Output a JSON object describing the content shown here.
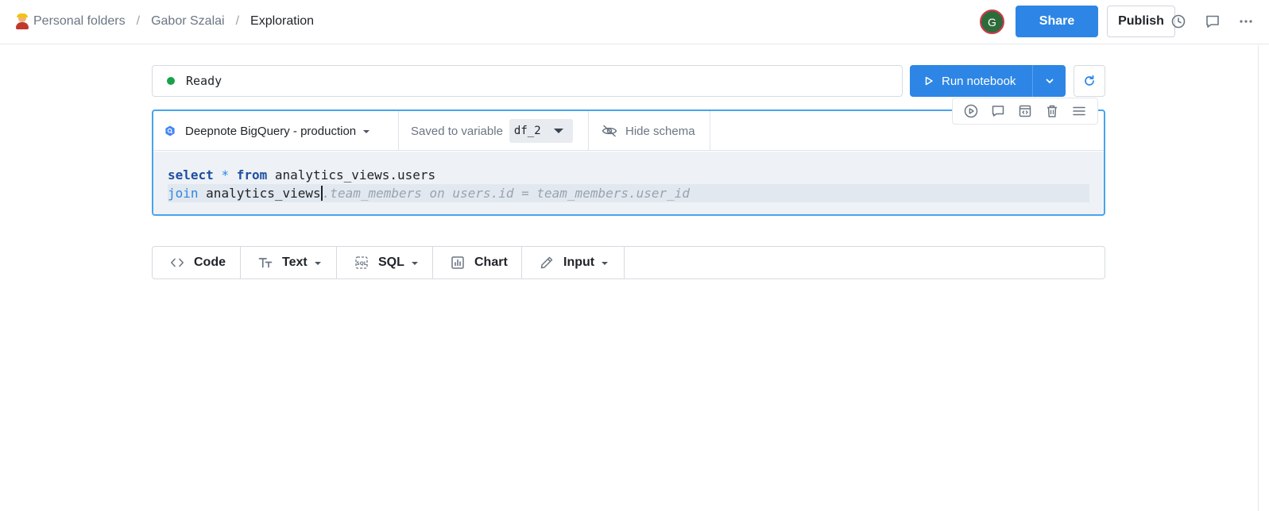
{
  "breadcrumb": {
    "items": [
      "Personal folders",
      "Gabor Szalai",
      "Exploration"
    ],
    "separator": "/"
  },
  "header": {
    "avatar_initial": "G",
    "share_label": "Share",
    "publish_label": "Publish",
    "icons": [
      "history-icon",
      "comments-icon",
      "more-icon"
    ]
  },
  "status": {
    "text": "Ready",
    "color": "#18a34a"
  },
  "run": {
    "label": "Run notebook"
  },
  "sql_cell": {
    "connection": "Deepnote BigQuery - production",
    "saved_to_label": "Saved to variable",
    "variable": "df_2",
    "schema_toggle_label": "Hide schema",
    "code": {
      "line1": {
        "select": "select",
        "star": "*",
        "from": "from",
        "table": "analytics_views.users"
      },
      "line2": {
        "join": "join",
        "typed": "analytics_views",
        "suggestion": ".team_members on users.id = team_members.user_id"
      }
    }
  },
  "add_block": {
    "code": "Code",
    "text": "Text",
    "sql": "SQL",
    "chart": "Chart",
    "input": "Input"
  },
  "colors": {
    "accent": "#2d86e5",
    "focus_border": "#4aa3ec"
  }
}
